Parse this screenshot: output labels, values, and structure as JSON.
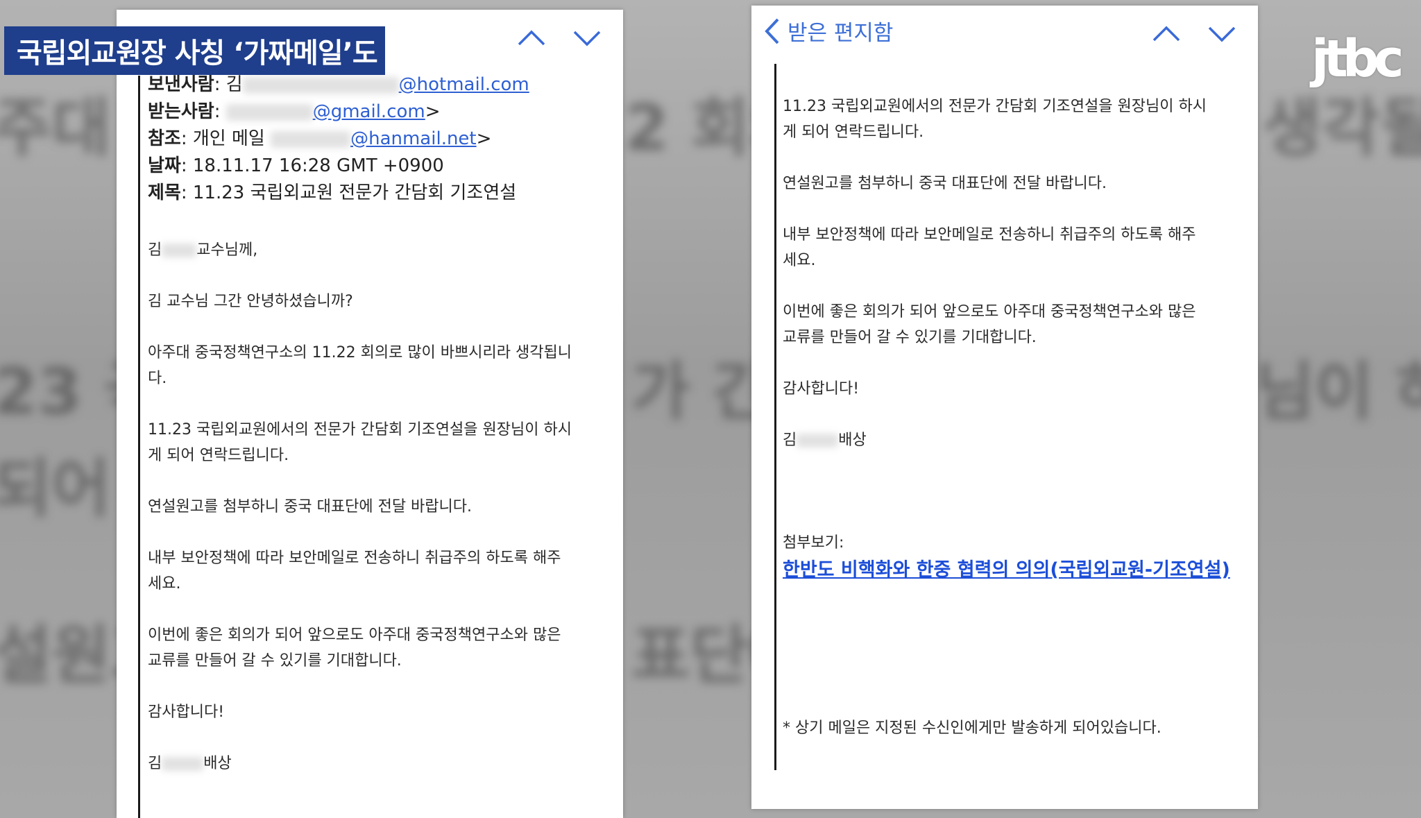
{
  "caption": "국립외교원장 사칭 ‘가짜메일’도",
  "logo": "jtbc",
  "background_words": [
    "주대",
    "2 회의",
    "생각될",
    "23 국",
    "가 간",
    "님이 하",
    "되어",
    "설원고",
    "표단에"
  ],
  "left_email": {
    "from_label": "보낸사람",
    "from_prefix": "김",
    "from_domain": "@hotmail.com",
    "to_label": "받는사람",
    "to_domain": "@gmail.com",
    "to_suffix": ">",
    "cc_label": "참조",
    "cc_prefix": "개인 메일",
    "cc_domain": "@hanmail.net",
    "cc_suffix": ">",
    "date_label": "날짜",
    "date_value": "18.11.17 16:28 GMT +0900",
    "subject_label": "제목",
    "subject_value": "11.23 국립외교원 전문가 간담회 기조연설",
    "greeting_prefix": "김",
    "greeting_suffix": "교수님께,",
    "p1": "김 교수님 그간 안녕하셨습니까?",
    "p2a": "아주대 중국정책연구소의 11.22 회의로 많이 바쁘시리라 생각됩니",
    "p2b": "다.",
    "p3a": "11.23 국립외교원에서의 전문가 간담회 기조연설을 원장님이 하시",
    "p3b": "게 되어 연락드립니다.",
    "p4": "연설원고를 첨부하니 중국 대표단에 전달 바랍니다.",
    "p5a": "내부 보안정책에 따라 보안메일로 전송하니 취급주의 하도록 해주",
    "p5b": "세요.",
    "p6a": "이번에 좋은 회의가 되어 앞으로도 아주대 중국정책연구소와 많은",
    "p6b": "교류를 만들어 갈 수 있기를 기대합니다.",
    "p7": "감사합니다!",
    "sign_prefix": "김",
    "sign_suffix": "배상"
  },
  "right_email": {
    "back_label": "받은 편지함",
    "p3a": "11.23 국립외교원에서의 전문가 간담회 기조연설을 원장님이 하시",
    "p3b": "게 되어 연락드립니다.",
    "p4": "연설원고를 첨부하니 중국 대표단에 전달 바랍니다.",
    "p5a": "내부 보안정책에 따라 보안메일로 전송하니 취급주의 하도록 해주",
    "p5b": "세요.",
    "p6a": "이번에 좋은 회의가 되어 앞으로도 아주대 중국정책연구소와 많은",
    "p6b": "교류를 만들어 갈 수 있기를 기대합니다.",
    "p7": "감사합니다!",
    "sign_prefix": "김",
    "sign_suffix": "배상",
    "attachment_label": "첨부보기:",
    "attachment_link": "한반도 비핵화와 한중 협력의 의의(국립외교원-기조연설)",
    "footer_note": "* 상기 메일은 지정된 수신인에게만 발송하게 되어있습니다."
  },
  "icons": {
    "prev": "chevron-up-icon",
    "next": "chevron-down-icon",
    "back": "chevron-left-icon"
  },
  "colors": {
    "caption_bg": "#1f3e8c",
    "link": "#2d5fd3",
    "back_title": "#3d6fd6"
  }
}
